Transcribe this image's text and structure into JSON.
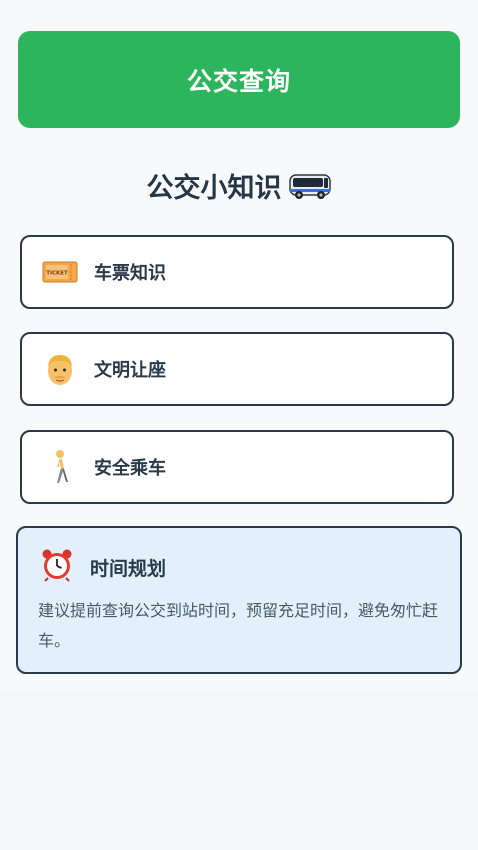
{
  "header": {
    "query_button_label": "公交查询"
  },
  "section": {
    "title": "公交小知识",
    "title_icon": "bus-icon"
  },
  "cards": [
    {
      "label": "车票知识",
      "icon": "ticket-icon"
    },
    {
      "label": "文明让座",
      "icon": "man-icon"
    },
    {
      "label": "安全乘车",
      "icon": "walking-person-icon"
    }
  ],
  "tip": {
    "title": "时间规划",
    "icon": "alarm-clock-icon",
    "text": "建议提前查询公交到站时间，预留充足时间，避免匆忙赶车。"
  },
  "colors": {
    "primary": "#2db55d",
    "card_border": "#2b3a4a",
    "tip_bg": "#e3f0fb",
    "page_bg": "#f5f6f8"
  }
}
